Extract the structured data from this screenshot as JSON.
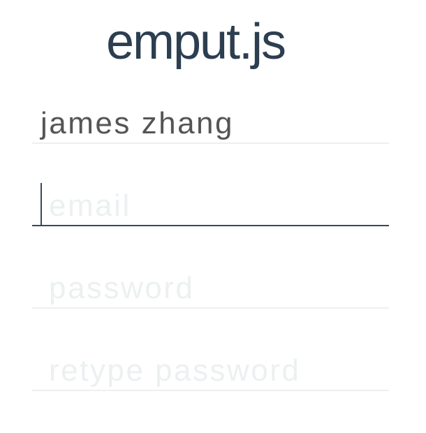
{
  "app": {
    "title": "emput.js"
  },
  "form": {
    "name": {
      "value": "james zhang"
    },
    "email": {
      "placeholder": "email",
      "focused": true
    },
    "password": {
      "placeholder": "password"
    },
    "retype_password": {
      "placeholder": "retype password"
    }
  },
  "colors": {
    "title": "#2c3e50",
    "text": "#555555",
    "placeholder": "#ecf0f1",
    "focus_line": "#34495e",
    "line": "#ecf0f1"
  }
}
